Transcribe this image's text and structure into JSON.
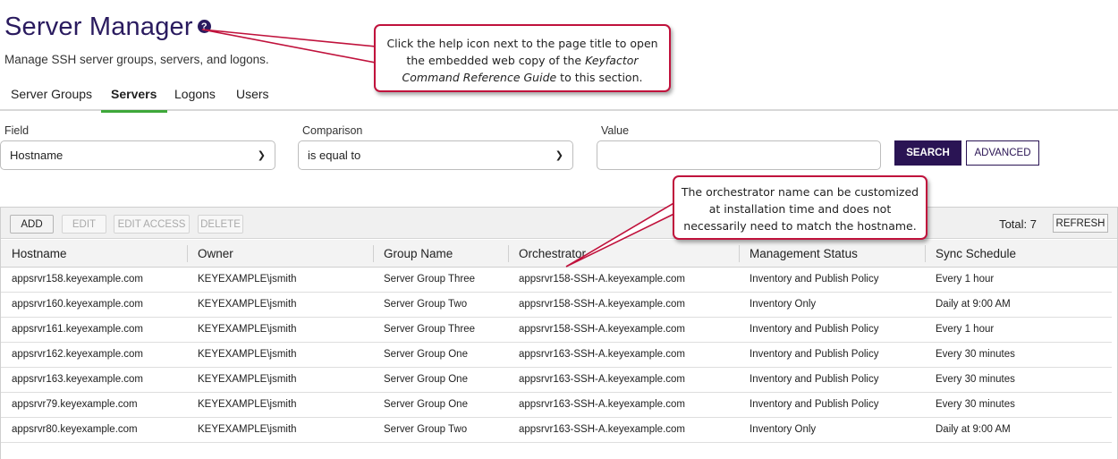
{
  "page": {
    "title": "Server Manager",
    "help_icon_glyph": "?",
    "subtitle": "Manage SSH server groups, servers, and logons."
  },
  "tabs": [
    {
      "label": "Server Groups",
      "active": false
    },
    {
      "label": "Servers",
      "active": true
    },
    {
      "label": "Logons",
      "active": false
    },
    {
      "label": "Users",
      "active": false
    }
  ],
  "filter": {
    "field_label": "Field",
    "field_value": "Hostname",
    "comparison_label": "Comparison",
    "comparison_value": "is equal to",
    "value_label": "Value",
    "value_input": "",
    "search_label": "SEARCH",
    "advanced_label": "ADVANCED"
  },
  "toolbar": {
    "add": "ADD",
    "edit": "EDIT",
    "edit_access": "EDIT ACCESS",
    "delete": "DELETE",
    "total": "Total: 7",
    "refresh": "REFRESH"
  },
  "table": {
    "columns": [
      "Hostname",
      "Owner",
      "Group Name",
      "Orchestrator",
      "Management Status",
      "Sync Schedule"
    ],
    "rows": [
      [
        "appsrvr158.keyexample.com",
        "KEYEXAMPLE\\jsmith",
        "Server Group Three",
        "appsrvr158-SSH-A.keyexample.com",
        "Inventory and Publish Policy",
        "Every 1 hour"
      ],
      [
        "appsrvr160.keyexample.com",
        "KEYEXAMPLE\\jsmith",
        "Server Group Two",
        "appsrvr158-SSH-A.keyexample.com",
        "Inventory Only",
        "Daily at 9:00 AM"
      ],
      [
        "appsrvr161.keyexample.com",
        "KEYEXAMPLE\\jsmith",
        "Server Group Three",
        "appsrvr158-SSH-A.keyexample.com",
        "Inventory and Publish Policy",
        "Every 1 hour"
      ],
      [
        "appsrvr162.keyexample.com",
        "KEYEXAMPLE\\jsmith",
        "Server Group One",
        "appsrvr163-SSH-A.keyexample.com",
        "Inventory and Publish Policy",
        "Every 30 minutes"
      ],
      [
        "appsrvr163.keyexample.com",
        "KEYEXAMPLE\\jsmith",
        "Server Group One",
        "appsrvr163-SSH-A.keyexample.com",
        "Inventory and Publish Policy",
        "Every 30 minutes"
      ],
      [
        "appsrvr79.keyexample.com",
        "KEYEXAMPLE\\jsmith",
        "Server Group One",
        "appsrvr163-SSH-A.keyexample.com",
        "Inventory and Publish Policy",
        "Every 30 minutes"
      ],
      [
        "appsrvr80.keyexample.com",
        "KEYEXAMPLE\\jsmith",
        "Server Group Two",
        "appsrvr163-SSH-A.keyexample.com",
        "Inventory Only",
        "Daily at 9:00 AM"
      ]
    ]
  },
  "callouts": {
    "help": {
      "line1": "Click the help icon next to the page title to open",
      "line2": "the embedded web copy of the ",
      "line2_italic": "Keyfactor",
      "line3_italic": "Command Reference Guide",
      "line3": " to this section."
    },
    "orchestrator": {
      "line1": "The orchestrator name can be customized",
      "line2": "at installation time and does not",
      "line3": "necessarily need to match the hostname."
    }
  },
  "colors": {
    "title": "#2a1b5f",
    "primary_button": "#2a1454",
    "active_tab_underline": "#3ea83a",
    "callout_border": "#c0123c"
  }
}
